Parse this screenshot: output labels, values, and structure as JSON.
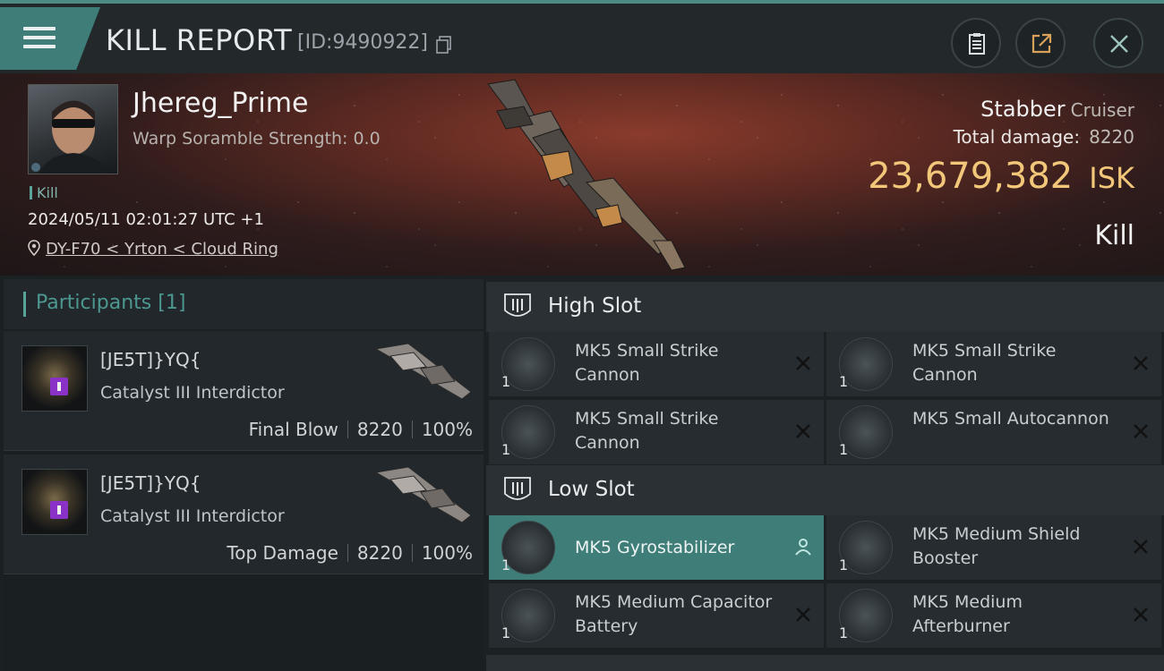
{
  "header": {
    "title": "KILL REPORT",
    "report_id": "[ID:9490922]"
  },
  "victim": {
    "pilot_name": "Jhereg_Prime",
    "warp_scramble": "Warp Soramble Strength: 0.0",
    "tag": "Kill",
    "datetime": "2024/05/11 02:01:27 UTC +1",
    "location": "DY-F70 < Yrton < Cloud Ring",
    "ship_name": "Stabber",
    "ship_class": "Cruiser",
    "total_damage_label": "Total damage:",
    "total_damage": "8220",
    "isk_value": "23,679,382",
    "isk_unit": "ISK",
    "result": "Kill"
  },
  "participants": {
    "title": "Participants",
    "count": "[1]",
    "items": [
      {
        "corp": "[JE5T]}YQ{",
        "ship": "Catalyst III Interdictor",
        "role": "Final Blow",
        "damage": "8220",
        "percent": "100%"
      },
      {
        "corp": "[JE5T]}YQ{",
        "ship": "Catalyst III Interdictor",
        "role": "Top Damage",
        "damage": "8220",
        "percent": "100%"
      }
    ]
  },
  "high_slot": {
    "title": "High Slot",
    "modules": [
      {
        "name": "MK5 Small Strike Cannon",
        "qty": "1"
      },
      {
        "name": "MK5 Small Strike Cannon",
        "qty": "1"
      },
      {
        "name": "MK5 Small Strike Cannon",
        "qty": "1"
      },
      {
        "name": "MK5 Small Autocannon",
        "qty": "1"
      }
    ]
  },
  "low_slot": {
    "title": "Low Slot",
    "modules": [
      {
        "name": "MK5 Gyrostabilizer",
        "qty": "1"
      },
      {
        "name": "MK5 Medium Shield Booster",
        "qty": "1"
      },
      {
        "name": "MK5 Medium Capacitor Battery",
        "qty": "1"
      },
      {
        "name": "MK5 Medium Afterburner",
        "qty": "1"
      }
    ]
  },
  "colors": {
    "accent": "#3f7d78",
    "isk": "#f2c77a",
    "badge": "#8a32c8"
  }
}
